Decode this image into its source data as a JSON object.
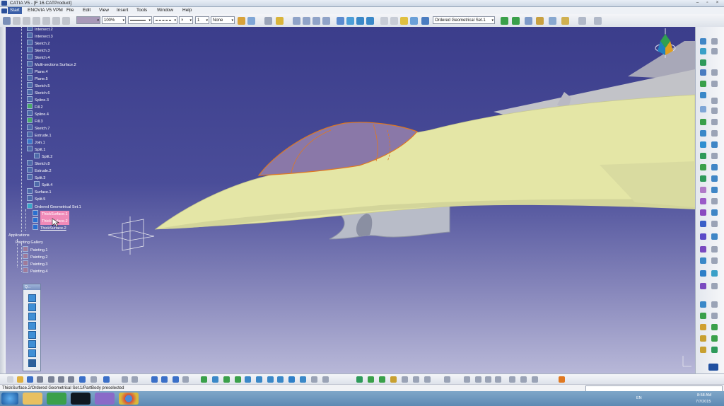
{
  "window": {
    "title": "CATIA V5 - [F 16.CATProduct]",
    "controls": [
      "–",
      "▫",
      "×"
    ]
  },
  "menu": [
    "Start",
    "ENOVIA V5 VPM",
    "File",
    "Edit",
    "View",
    "Insert",
    "Tools",
    "Window",
    "Help"
  ],
  "toolbar": {
    "zoom_value": "100%",
    "layer_value": "None",
    "line_weight_value": "1",
    "geometrical_set_value": "Ordered Geometrical Set.1"
  },
  "tree": {
    "nodes": [
      "Intersect.2",
      "Intersect.3",
      "Sketch.2",
      "Sketch.3",
      "Sketch.4",
      "Multi-sections Surface.2",
      "Plane.4",
      "Plane.5",
      "Sketch.5",
      "Sketch.6",
      "Spline.3",
      "Fill.2",
      "Spline.4",
      "Fill.3",
      "Sketch.7",
      "Extrude.1",
      "Join.1",
      "Split.1",
      "Split.2",
      "Sketch.8",
      "Extrude.2",
      "Split.3",
      "Split.4",
      "Surface.1",
      "Split.5",
      "Ordered Geometrical Set.1",
      "ThickSurface.1",
      "ThickSurface.2",
      "ThickSurface.2",
      "Applications",
      "Painting Gallery",
      "Painting.1",
      "Painting.2",
      "Painting.3",
      "Painting.4"
    ]
  },
  "status": {
    "message": "ThickSurface.2/Ordered Geometrical Set.1/PartBody preselected"
  },
  "taskbar": {
    "language": "EN",
    "time": "8:58 AM",
    "date": "7/7/2015"
  },
  "floating_toolbar": {
    "title": "Q..."
  },
  "colors": {
    "background_top": "#3b3d8b",
    "background_bottom": "#b8b8d8",
    "aircraft_body": "#e4e6a6",
    "canopy": "#8a78a8",
    "canopy_edge": "#e07820",
    "highlight": "#f08ab8"
  }
}
